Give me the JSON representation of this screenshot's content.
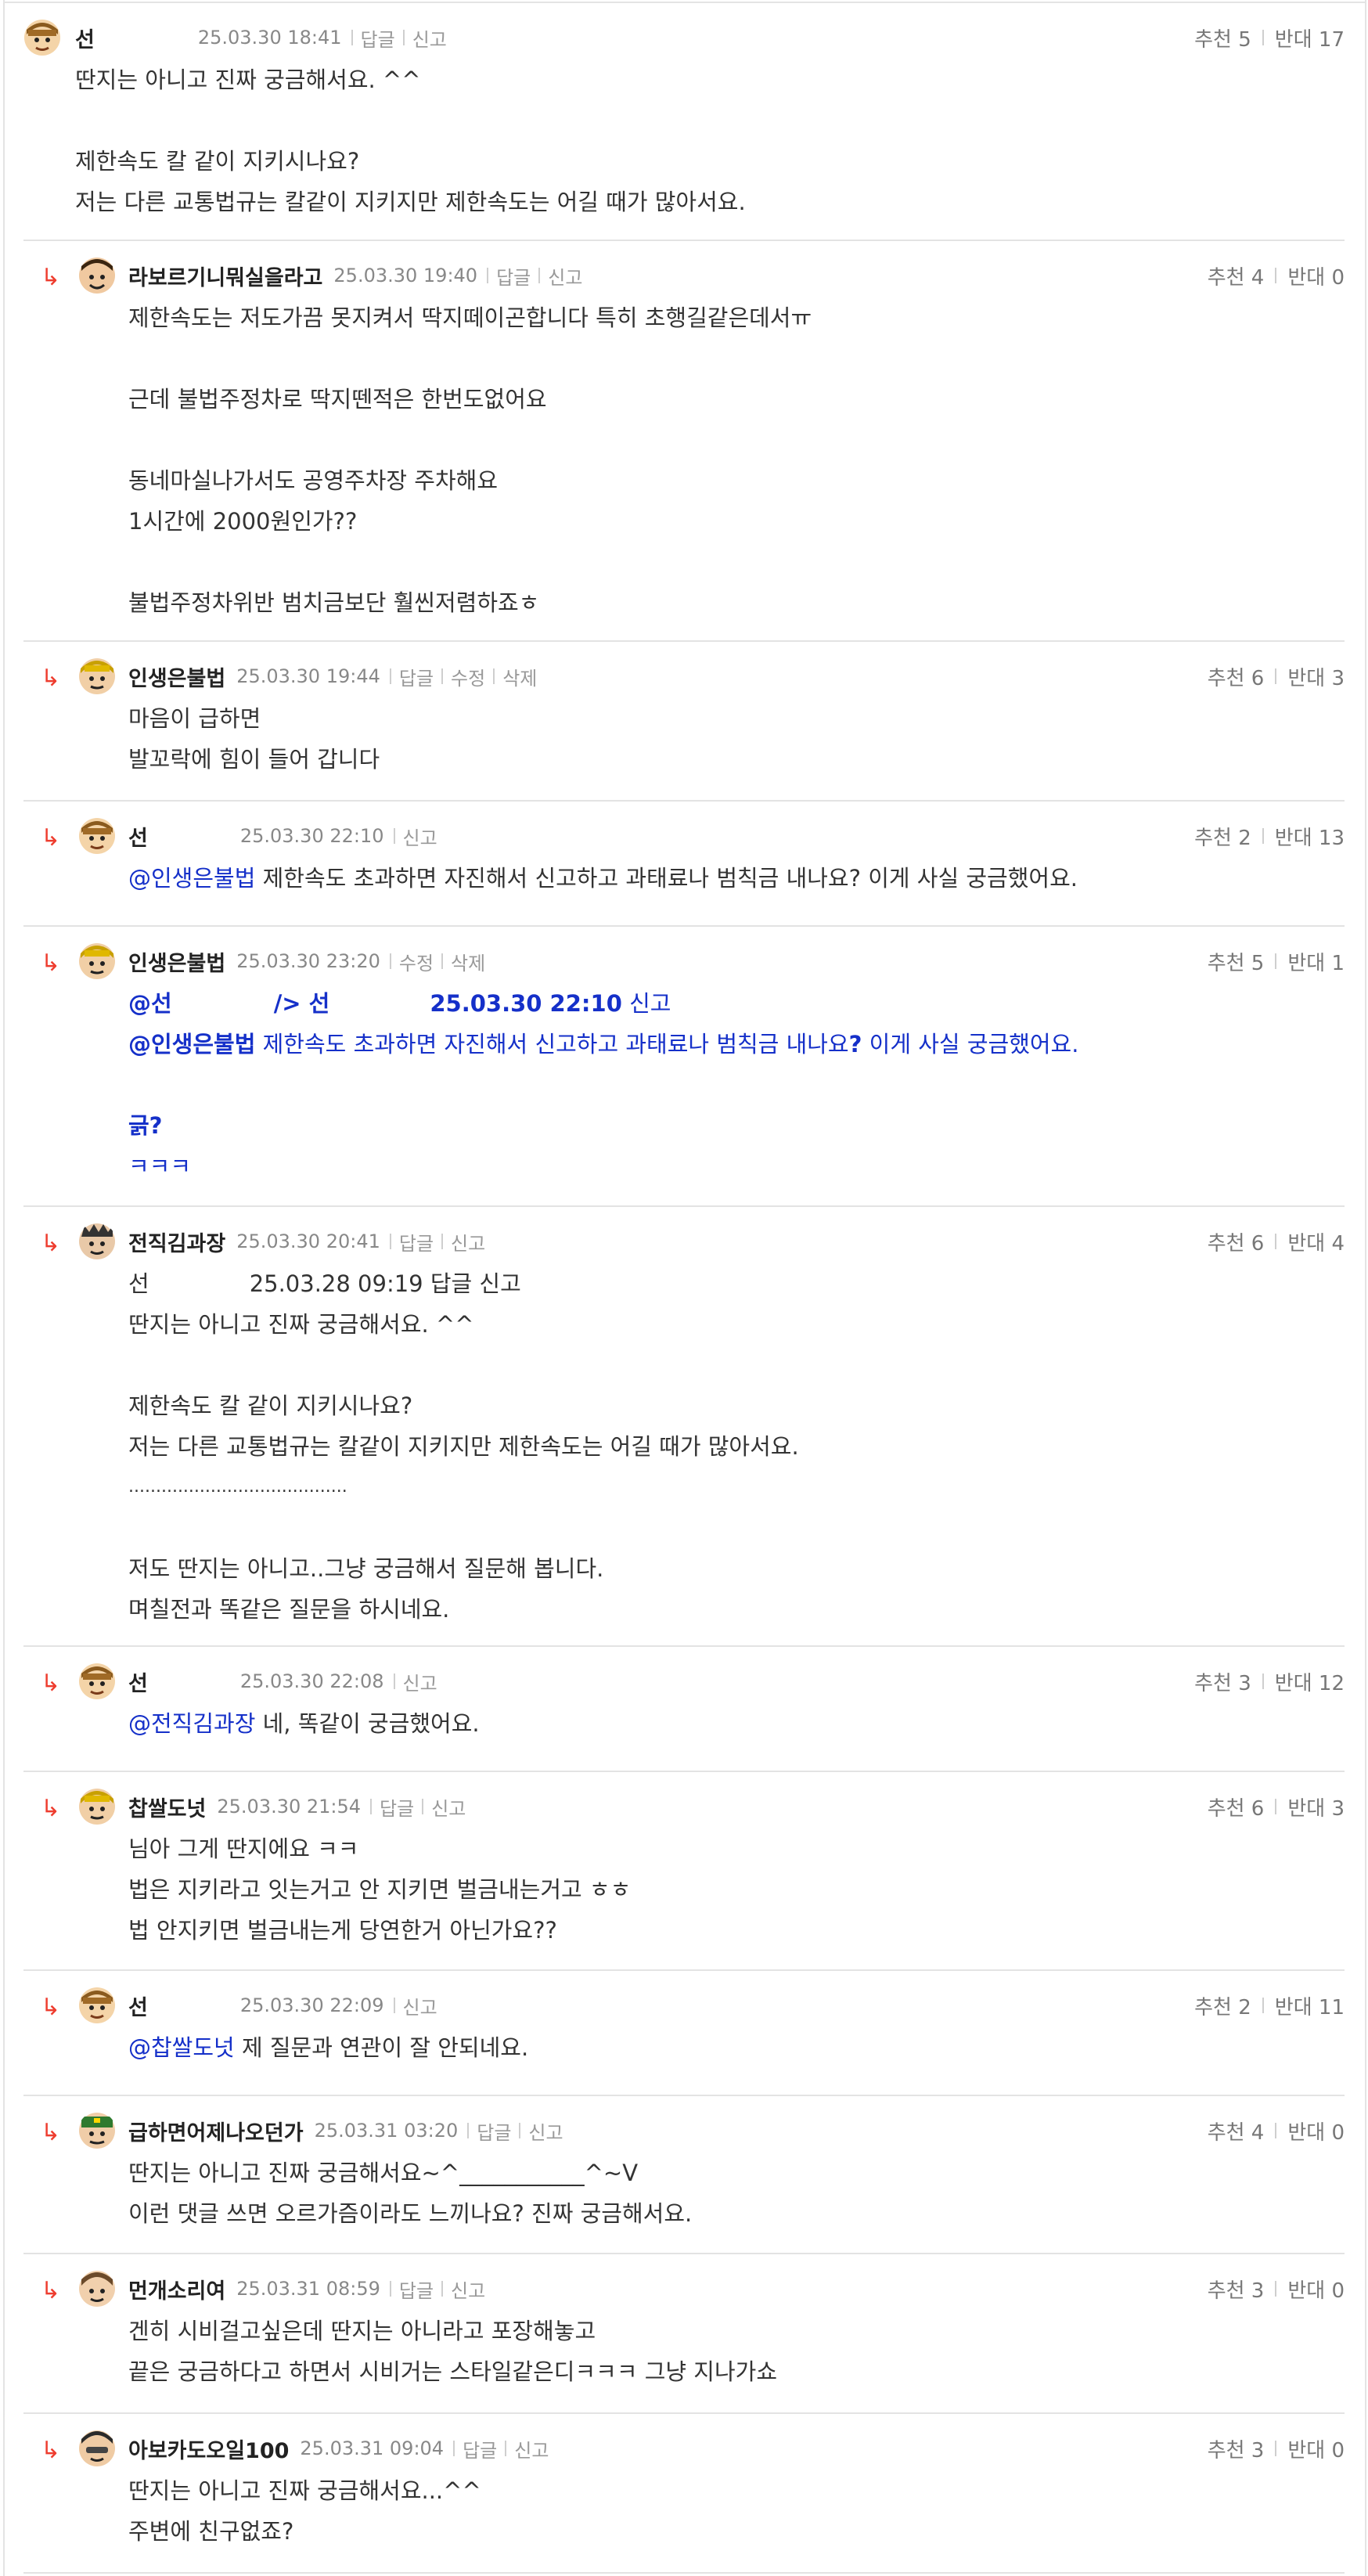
{
  "labels": {
    "reply": "답글",
    "report": "신고",
    "edit": "수정",
    "delete": "삭제",
    "upvote": "추천",
    "downvote": "반대"
  },
  "comments": [
    {
      "nick": "선",
      "date": "25.03.30 18:41",
      "up": "5",
      "down": "17",
      "lines": [
        "딴지는 아니고 진짜 궁금해서요. ^^",
        "",
        "제한속도 칼 같이 지키시나요?",
        "저는 다른 교통법규는 칼같이 지키지만 제한속도는 어길 때가 많아서요."
      ]
    },
    {
      "nick": "라보르기니뭐실을라고",
      "date": "25.03.30 19:40",
      "up": "4",
      "down": "0",
      "lines": [
        "제한속도는 저도가끔 못지켜서 딱지떼이곤합니다 특히 초행길같은데서ㅠ",
        "",
        "근데 불법주정차로 딱지뗀적은 한번도없어요",
        "",
        "동네마실나가서도 공영주차장 주차해요",
        "1시간에 2000원인가??",
        "",
        "불법주정차위반 범치금보단 훨씬저렴하죠ㅎ"
      ]
    },
    {
      "nick": "인생은불법",
      "date": "25.03.30 19:44",
      "up": "6",
      "down": "3",
      "lines": [
        "마음이 급하면",
        "발꼬락에 힘이 들어 갑니다"
      ]
    },
    {
      "nick": "선",
      "date": "25.03.30 22:10",
      "up": "2",
      "down": "13",
      "mention": "@인생은불법",
      "text": " 제한속도 초과하면 자진해서 신고하고 과태료나 범칙금 내나요? 이게 사실 궁금했어요."
    },
    {
      "nick": "인생은불법",
      "date": "25.03.30 23:20",
      "up": "5",
      "down": "1",
      "quote_mention": "@선",
      "quote_head": "/> 선",
      "quote_date": "25.03.30 22:10",
      "quote_report": "신고",
      "quote_mention2": "@인생은불법",
      "quote_text1": " 제한속도 초과하면 자진해서 신고하고 과태료나 범칙금 내나요",
      "quote_qmark": "?",
      "quote_text2": " 이게 사실 궁금했어요.",
      "reply_bold1": "긁?",
      "reply_text2": "ㅋㅋㅋ"
    },
    {
      "nick": "전직김과장",
      "date": "25.03.30 20:41",
      "up": "6",
      "down": "4",
      "quote_nick": "선",
      "quote_date": "25.03.28 09:19",
      "quote_actions": "답글 신고",
      "lines": [
        "딴지는 아니고 진짜 궁금해서요. ^^",
        "",
        "제한속도 칼 같이 지키시나요?",
        "저는 다른 교통법규는 칼같이 지키지만 제한속도는 어길 때가 많아서요.",
        "........................................",
        "",
        "저도 딴지는 아니고..그냥 궁금해서 질문해 봅니다.",
        "며칠전과 똑같은 질문을 하시네요."
      ]
    },
    {
      "nick": "선",
      "date": "25.03.30 22:08",
      "up": "3",
      "down": "12",
      "mention": "@전직김과장",
      "text": " 네, 똑같이 궁금했어요."
    },
    {
      "nick": "찹쌀도넛",
      "date": "25.03.30 21:54",
      "up": "6",
      "down": "3",
      "lines": [
        "님아 그게 딴지에요 ㅋㅋ",
        "법은 지키라고 잇는거고 안 지키면 벌금내는거고 ㅎㅎ",
        "법 안지키면 벌금내는게 당연한거 아닌가요??"
      ]
    },
    {
      "nick": "선",
      "date": "25.03.30 22:09",
      "up": "2",
      "down": "11",
      "mention": "@찹쌀도넛",
      "text": " 제 질문과 연관이 잘 안되네요."
    },
    {
      "nick": "급하면어제나오던가",
      "date": "25.03.31 03:20",
      "up": "4",
      "down": "0",
      "lines": [
        "딴지는 아니고 진짜 궁금해서요~^___________^~V",
        "이런 댓글 쓰면 오르가즘이라도 느끼나요? 진짜 궁금해서요."
      ]
    },
    {
      "nick": "먼개소리여",
      "date": "25.03.31 08:59",
      "up": "3",
      "down": "0",
      "lines": [
        "겐히 시비걸고싶은데 딴지는 아니라고 포장해놓고",
        "끝은 궁금하다고 하면서 시비거는 스타일같은디ㅋㅋㅋ 그냥 지나가쇼"
      ]
    },
    {
      "nick": "아보카도오일100",
      "date": "25.03.31 09:04",
      "up": "3",
      "down": "0",
      "lines": [
        "딴지는 아니고 진짜 궁금해서요...^^",
        "주변에 친구없죠?"
      ]
    }
  ]
}
